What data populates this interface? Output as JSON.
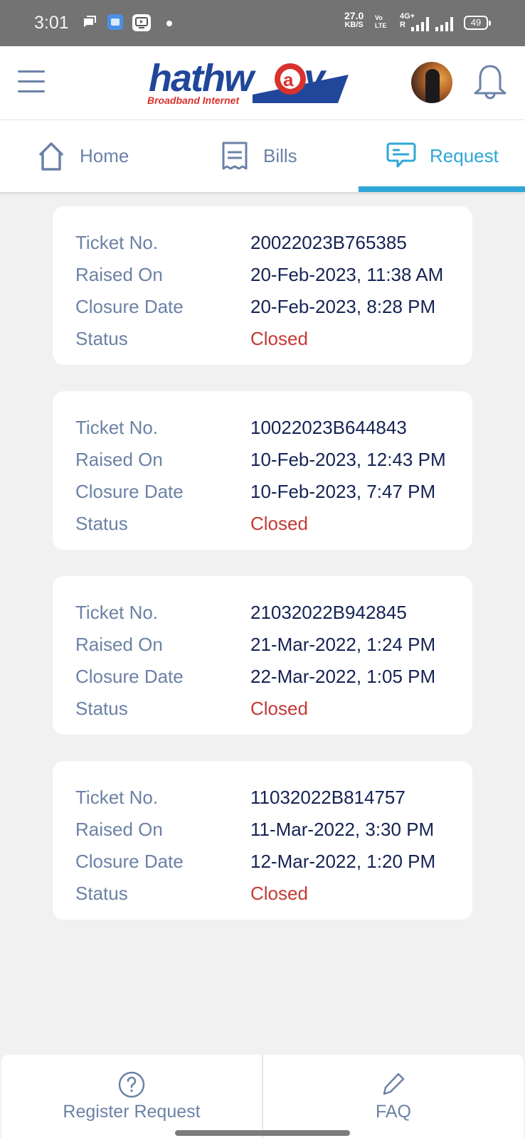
{
  "status_bar": {
    "time": "3:01",
    "net_speed": "27.0",
    "net_speed_unit": "KB/S",
    "volte_top": "Vo",
    "volte_bottom": "LTE",
    "network_type": "4G+",
    "roaming": "R",
    "battery": "49",
    "icons": [
      "chat-notification-icon",
      "app-notification-icon",
      "video-notification-icon",
      "more-dot-icon"
    ]
  },
  "header": {
    "logo_text": "hathw@y",
    "logo_subtext": "Broadband Internet",
    "brand_colors": {
      "blue": "#21479a",
      "red": "#d8322e"
    }
  },
  "tabs": [
    {
      "label": "Home",
      "icon": "home-icon",
      "active": false
    },
    {
      "label": "Bills",
      "icon": "receipt-icon",
      "active": false
    },
    {
      "label": "Request",
      "icon": "chat-bubble-icon",
      "active": true
    }
  ],
  "labels": {
    "ticket_no": "Ticket No.",
    "raised_on": "Raised On",
    "closure_date": "Closure Date",
    "status": "Status"
  },
  "tickets": [
    {
      "ticket_no": "20022023B765385",
      "raised_on": "20-Feb-2023, 11:38 AM",
      "closure_date": "20-Feb-2023, 8:28 PM",
      "status": "Closed"
    },
    {
      "ticket_no": "10022023B644843",
      "raised_on": "10-Feb-2023, 12:43 PM",
      "closure_date": "10-Feb-2023, 7:47 PM",
      "status": "Closed"
    },
    {
      "ticket_no": "21032022B942845",
      "raised_on": "21-Mar-2022, 1:24 PM",
      "closure_date": "22-Mar-2022, 1:05 PM",
      "status": "Closed"
    },
    {
      "ticket_no": "11032022B814757",
      "raised_on": "11-Mar-2022, 3:30 PM",
      "closure_date": "12-Mar-2022, 1:20 PM",
      "status": "Closed"
    }
  ],
  "bottom_bar": {
    "register_request": "Register Request",
    "faq": "FAQ"
  },
  "colors": {
    "accent": "#2fa7d6",
    "label": "#6b82a6",
    "value": "#142354",
    "status_closed": "#c43a35",
    "background": "#f1f1f1"
  }
}
